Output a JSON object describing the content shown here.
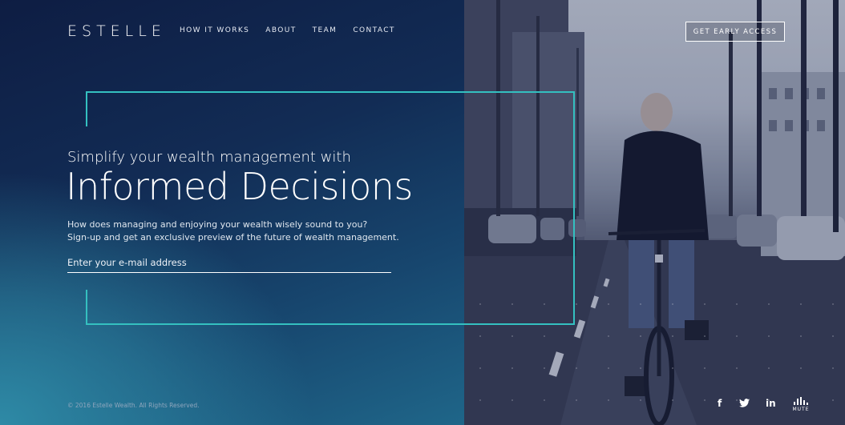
{
  "brand": {
    "logo": "ESTELLE"
  },
  "nav": {
    "items": [
      "HOW IT WORKS",
      "ABOUT",
      "TEAM",
      "CONTACT"
    ]
  },
  "header": {
    "cta_label": "GET EARLY ACCESS"
  },
  "hero": {
    "subtitle": "Simplify your wealth management with",
    "headline": "Informed Decisions",
    "description_line1": "How does managing and enjoying your wealth wisely sound to you?",
    "description_line2": "Sign-up and get an exclusive preview of the future of wealth management.",
    "email_placeholder": "Enter your e-mail address"
  },
  "footer": {
    "copyright": "© 2016 Estelle Wealth. All Rights Reserved.",
    "social": [
      {
        "icon": "facebook-icon",
        "glyph": "f"
      },
      {
        "icon": "twitter-icon",
        "glyph": "🐦"
      },
      {
        "icon": "linkedin-icon",
        "glyph": "in"
      }
    ],
    "mute_label": "MUTE"
  },
  "colors": {
    "accent": "#34c0c0",
    "dark_navy": "#0f2146",
    "teal": "#2e8aa6"
  }
}
